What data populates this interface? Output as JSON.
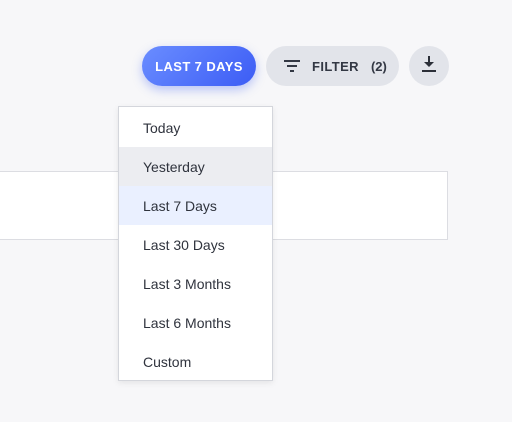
{
  "toolbar": {
    "range_label": "LAST 7 DAYS",
    "filter_label": "FILTER",
    "filter_count": "(2)",
    "filter_icon": "filter-lines-icon",
    "download_icon": "download-icon"
  },
  "dropdown": {
    "items": [
      {
        "label": "Today"
      },
      {
        "label": "Yesterday",
        "state": "hover"
      },
      {
        "label": "Last 7 Days",
        "state": "selected"
      },
      {
        "label": "Last 30 Days"
      },
      {
        "label": "Last 3 Months"
      },
      {
        "label": "Last 6 Months"
      },
      {
        "label": "Custom"
      }
    ]
  },
  "colors": {
    "accent_start": "#6a8dff",
    "accent_end": "#3c5cf5",
    "hover_bg": "#ecedf1",
    "selected_bg": "#eaf0ff",
    "page_bg": "#f7f7f9"
  }
}
